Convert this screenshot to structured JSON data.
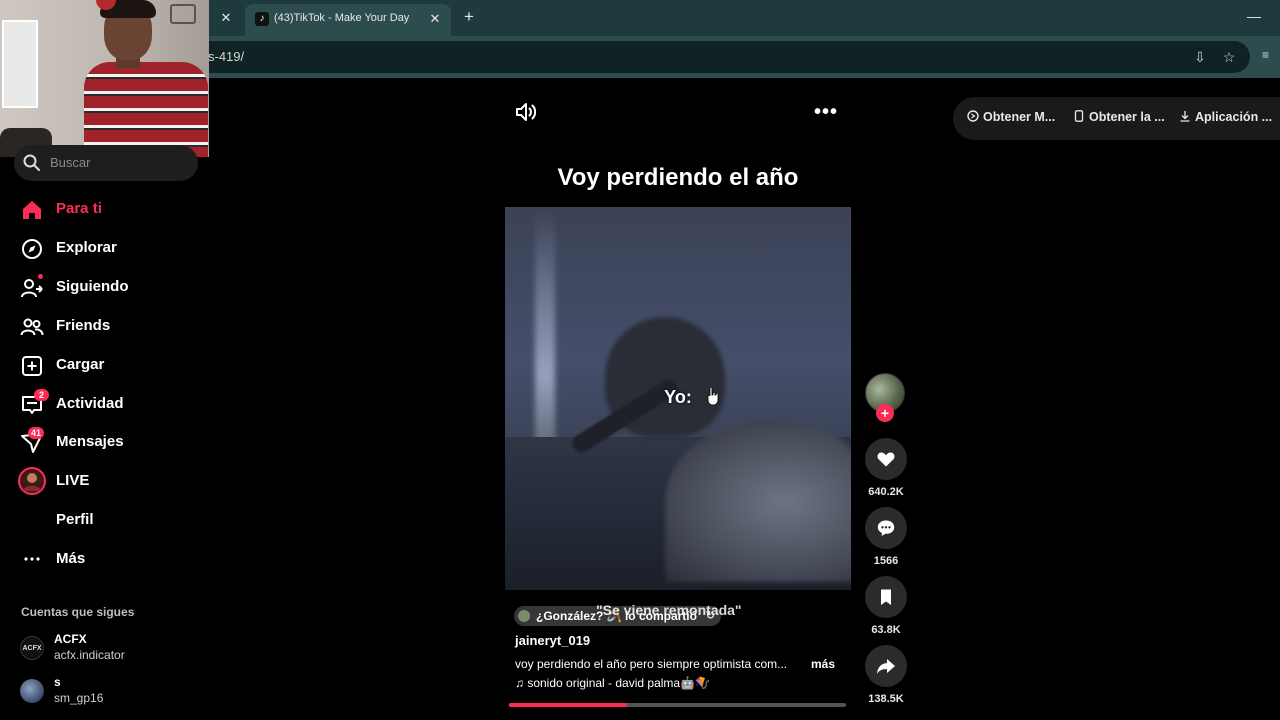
{
  "browser": {
    "tab_title": "(43)TikTok - Make Your Day",
    "url_fragment": "s-419/"
  },
  "sidebar": {
    "search_placeholder": "Buscar",
    "items": [
      {
        "label": "Para ti",
        "icon": "home-icon",
        "active": true
      },
      {
        "label": "Explorar",
        "icon": "compass-icon"
      },
      {
        "label": "Siguiendo",
        "icon": "following-icon",
        "dot": true
      },
      {
        "label": "Friends",
        "icon": "friends-icon"
      },
      {
        "label": "Cargar",
        "icon": "upload-icon"
      },
      {
        "label": "Actividad",
        "icon": "activity-icon",
        "badge": "2"
      },
      {
        "label": "Mensajes",
        "icon": "messages-icon",
        "badge": "41"
      },
      {
        "label": "LIVE",
        "icon": "live-icon"
      },
      {
        "label": "Perfil",
        "icon": "profile-icon"
      },
      {
        "label": "Más",
        "icon": "more-icon"
      }
    ],
    "following_title": "Cuentas que sigues",
    "accounts": [
      {
        "name": "ACFX",
        "handle": "acfx.indicator",
        "avatar_text": "ACFX"
      },
      {
        "name": "s",
        "handle": "sm_gp16"
      }
    ]
  },
  "video": {
    "title": "Voy perdiendo el año",
    "caption": "Yo:",
    "shared_text": "¿González? 🪃 lo compartió",
    "quote": "\"Se viene remontada\"",
    "author": "jaineryt_019",
    "description": "voy perdiendo el año pero siempre optimista com...",
    "more": "más",
    "sound": "♫  sonido original - david palma🤖🪁",
    "progress_fraction": 0.35
  },
  "actions": {
    "likes": "640.2K",
    "comments": "1566",
    "saves": "63.8K",
    "shares": "138.5K"
  },
  "get_app": {
    "item1": "Obtener M...",
    "item2": "Obtener la ...",
    "item3": "Aplicación ..."
  },
  "colors": {
    "accent": "#fe2c55",
    "chrome": "#2d4c4e"
  }
}
